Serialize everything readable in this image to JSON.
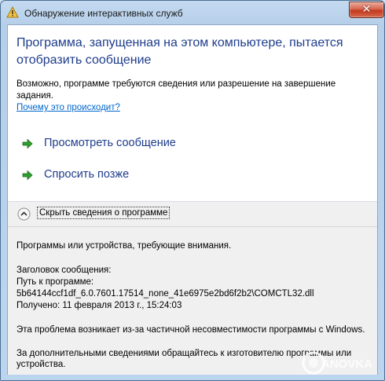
{
  "window": {
    "title": "Обнаружение интерактивных служб",
    "close_glyph": "✕"
  },
  "main": {
    "heading": "Программа, запущенная на этом компьютере, пытается отобразить сообщение",
    "description": "Возможно, программе требуются сведения или разрешение на завершение задания.",
    "help_link": "Почему это происходит?"
  },
  "commands": [
    {
      "label": "Просмотреть сообщение",
      "icon": "green-arrow-icon"
    },
    {
      "label": "Спросить позже",
      "icon": "green-arrow-icon"
    }
  ],
  "details_toggle": {
    "label": "Скрыть сведения о программе",
    "icon": "chevron-up-icon"
  },
  "details": {
    "programs_line": "Программы или устройства, требующие внимания.",
    "message_title_label": "Заголовок сообщения:",
    "program_path_label": "Путь к программе:",
    "program_path_value": "5b64144ccf1df_6.0.7601.17514_none_41e6975e2bd6f2b2\\COMCTL32.dll",
    "received_label": "Получено:",
    "received_value": "11 февраля 2013 г., 15:24:03",
    "problem_text": "Эта проблема возникает из-за частичной несовместимости программы с Windows.",
    "contact_text": "За дополнительными сведениями обращайтесь к изготовителю программы или устройства."
  },
  "watermark": {
    "text": "LANOVKA"
  },
  "colors": {
    "heading": "#1e3c8c",
    "link": "#0066cc",
    "arrow": "#2e9e2e",
    "close": "#c2391e"
  }
}
